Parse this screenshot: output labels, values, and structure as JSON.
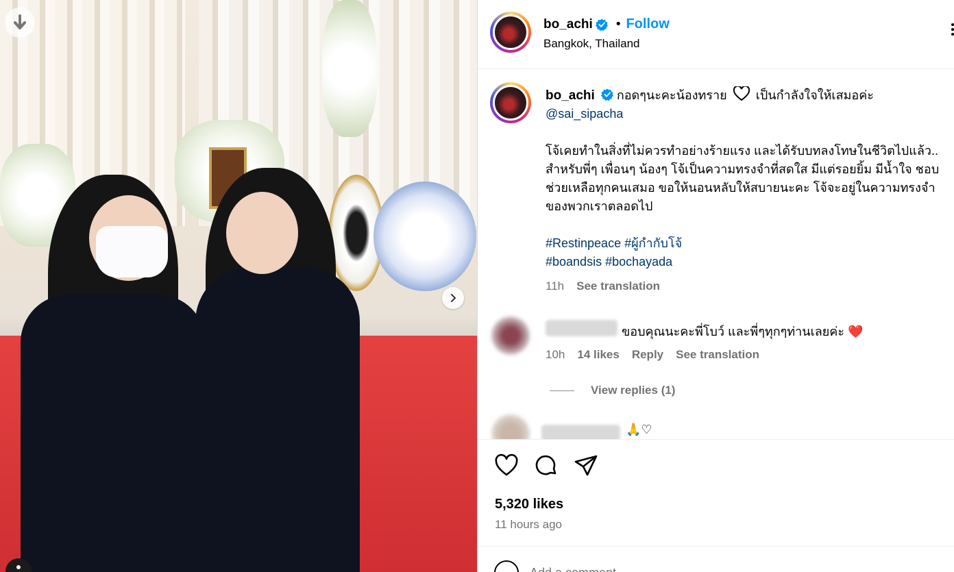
{
  "post": {
    "image_alt": "Two women in black at a memorial ceremony",
    "account": {
      "username": "bo_achi",
      "verified": true,
      "location": "Bangkok, Thailand",
      "follow_label": "Follow",
      "separator": "•"
    },
    "caption": {
      "username": "bo_achi",
      "line1": "กอดๆนะคะน้องทราย",
      "line1_after_heart": "เป็นกำลังใจให้เสมอค่ะ",
      "mention": "@sai_sipacha",
      "body": "โจ้เคยทำในสิ่งที่ไม่ควรทำอย่างร้ายแรง และได้รับบทลงโทษในชีวิตไปแล้ว.. สำหรับพี่ๆ เพื่อนๆ น้องๆ โจ้เป็นความทรงจำที่สดใส มีแต่รอยยิ้ม มีน้ำใจ ชอบช่วยเหลือทุกคนเสมอ ขอให้นอนหลับให้สบายนะคะ โจ้จะอยู่ในความทรงจำของพวกเราตลอดไป",
      "hashtag1": "#Restinpeace",
      "hashtag2": "#ผู้กำกับโจ้",
      "hashtag3": "#boandsis",
      "hashtag4": "#bochayada",
      "time": "11h",
      "see_translation": "See translation"
    },
    "comments": [
      {
        "text": "ขอบคุณนะคะพี่โบว์ และพี่ๆทุกๆท่านเลยค่ะ",
        "emoji": "❤️",
        "time": "10h",
        "likes": "14 likes",
        "reply": "Reply",
        "see_translation": "See translation",
        "view_replies": "View replies (1)"
      },
      {
        "text": "🙏♡"
      }
    ],
    "likes": "5,320 likes",
    "posted": "11 hours ago",
    "add_comment_placeholder": "Add a comment..."
  },
  "colors": {
    "follow_blue": "#0095f6",
    "link_blue": "#00376b",
    "secondary_text": "#737373",
    "verified_blue": "#0095f6"
  },
  "icons": [
    "download-icon",
    "chevron-right-icon",
    "verified-icon",
    "more-options-icon",
    "heart-icon",
    "comment-icon",
    "share-icon",
    "emoji-icon",
    "user-tag-icon"
  ]
}
